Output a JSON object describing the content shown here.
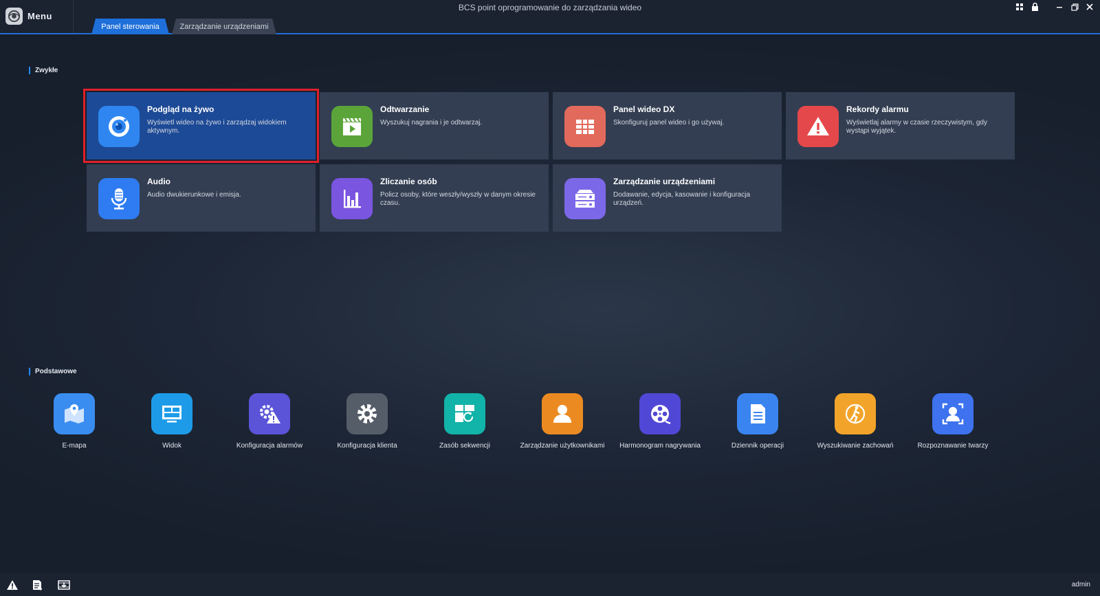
{
  "window": {
    "title": "BCS point oprogramowanie do zarządzania wideo",
    "menu_label": "Menu"
  },
  "tabs": [
    {
      "label": "Panel sterowania",
      "active": true
    },
    {
      "label": "Zarządzanie urządzeniami",
      "active": false
    }
  ],
  "sections": {
    "common": "Zwykłe",
    "basic": "Podstawowe"
  },
  "cards": [
    {
      "title": "Podgląd na żywo",
      "desc": "Wyświetl wideo na żywo i zarządzaj widokiem aktywnym.",
      "icon": "camera-icon",
      "color": "#2f86f0"
    },
    {
      "title": "Odtwarzanie",
      "desc": "Wyszukuj nagrania i je odtwarzaj.",
      "icon": "clapperboard-icon",
      "color": "#5ba43a"
    },
    {
      "title": "Panel wideo DX",
      "desc": "Skonfiguruj panel wideo i go używaj.",
      "icon": "video-wall-icon",
      "color": "#e26a5c"
    },
    {
      "title": "Rekordy alarmu",
      "desc": "Wyświetlaj alarmy w czasie rzeczywistym, gdy wystąpi wyjątek.",
      "icon": "alarm-warning-icon",
      "color": "#e5484b"
    },
    {
      "title": "Audio",
      "desc": "Audio dwukierunkowe i emisja.",
      "icon": "microphone-icon",
      "color": "#2f7cf2"
    },
    {
      "title": "Zliczanie osób",
      "desc": "Policz osoby, które weszły/wyszły w danym okresie czasu.",
      "icon": "bar-chart-icon",
      "color": "#7a55e0"
    },
    {
      "title": "Zarządzanie urządzeniami",
      "desc": "Dodawanie, edycja, kasowanie i konfiguracja urządzeń.",
      "icon": "server-device-icon",
      "color": "#7b68e8"
    }
  ],
  "tools": [
    {
      "label": "E-mapa",
      "icon": "map-icon",
      "color": "#3a8df0"
    },
    {
      "label": "Widok",
      "icon": "view-layout-icon",
      "color": "#1e9be8"
    },
    {
      "label": "Konfiguracja alarmów",
      "icon": "alarm-config-icon",
      "color": "#5b54d8"
    },
    {
      "label": "Konfiguracja klienta",
      "icon": "gear-icon",
      "color": "#555d68"
    },
    {
      "label": "Zasób sekwencji",
      "icon": "sequence-icon",
      "color": "#12b3a8"
    },
    {
      "label": "Zarządzanie użytkownikami",
      "icon": "user-icon",
      "color": "#ec8a22"
    },
    {
      "label": "Harmonogram nagrywania",
      "icon": "film-reel-icon",
      "color": "#5147d6"
    },
    {
      "label": "Dziennik operacji",
      "icon": "document-log-icon",
      "color": "#3a84f0"
    },
    {
      "label": "Wyszukiwanie zachowań",
      "icon": "behavior-search-icon",
      "color": "#f2a42a"
    },
    {
      "label": "Rozpoznawanie twarzy",
      "icon": "face-recognition-icon",
      "color": "#3e72ef"
    }
  ],
  "status": {
    "user": "admin"
  }
}
